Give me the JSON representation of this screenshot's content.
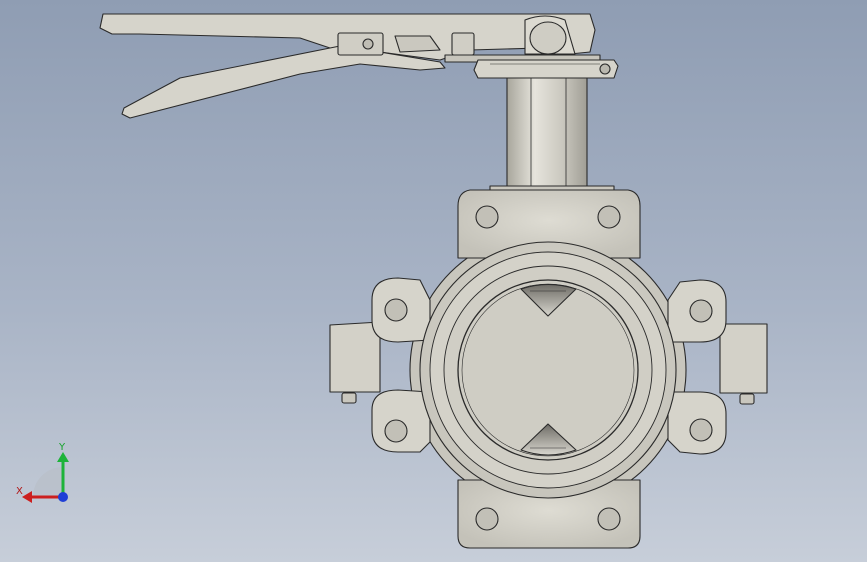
{
  "viewport": {
    "background_top": "#8f9db3",
    "background_bottom": "#c7ced9"
  },
  "model": {
    "part_color": "#d6d4cb",
    "edge_color": "#2a2a2a",
    "shadow_color": "#9b998f"
  },
  "triad": {
    "x_label": "X",
    "y_label": "Y",
    "x_color": "#cc1f1f",
    "y_color": "#1db33a",
    "z_color": "#1f3fd6"
  }
}
